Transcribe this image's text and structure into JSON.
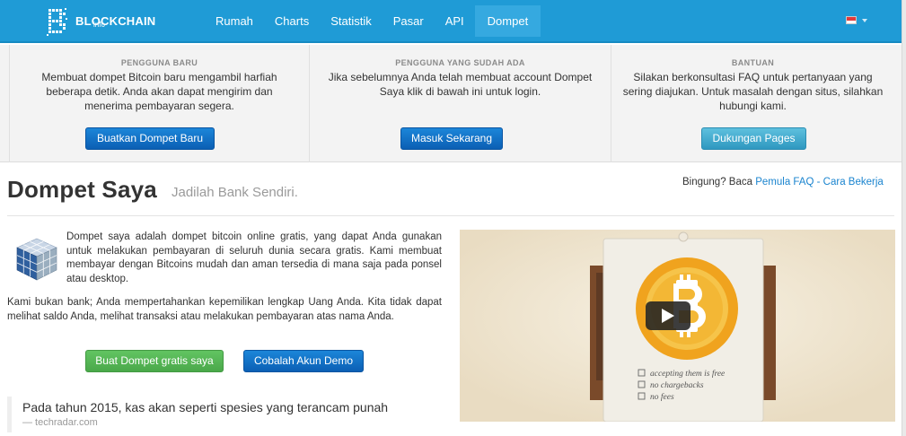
{
  "brand": {
    "name": "BLOCKCHAIN",
    "sub": "info"
  },
  "nav": {
    "items": [
      {
        "label": "Rumah"
      },
      {
        "label": "Charts"
      },
      {
        "label": "Statistik"
      },
      {
        "label": "Pasar"
      },
      {
        "label": "API"
      },
      {
        "label": "Dompet",
        "active": true
      }
    ]
  },
  "band": {
    "new_user": {
      "heading": "PENGGUNA BARU",
      "text": "Membuat dompet Bitcoin baru mengambil harfiah beberapa detik. Anda akan dapat mengirim dan menerima pembayaran segera.",
      "button": "Buatkan Dompet Baru"
    },
    "existing_user": {
      "heading": "PENGGUNA YANG SUDAH ADA",
      "text": "Jika sebelumnya Anda telah membuat account Dompet Saya klik di bawah ini untuk login.",
      "button": "Masuk Sekarang"
    },
    "help": {
      "heading": "BANTUAN",
      "text": "Silakan berkonsultasi FAQ untuk pertanyaan yang sering diajukan. Untuk masalah dengan situs, silahkan hubungi kami.",
      "button": "Dukungan Pages"
    }
  },
  "main": {
    "title": "Dompet Saya",
    "subtitle": "Jadilah Bank Sendiri.",
    "help_prefix": "Bingung? Baca",
    "help_link_faq": "Pemula FAQ",
    "help_sep": "-",
    "help_link_how": "Cara Bekerja",
    "paragraph1": "Dompet saya adalah dompet bitcoin online gratis, yang dapat Anda gunakan untuk melakukan pembayaran di seluruh dunia secara gratis. Kami membuat membayar dengan Bitcoins mudah dan aman tersedia di mana saja pada ponsel atau desktop.",
    "paragraph2": "Kami bukan bank; Anda mempertahankan kepemilikan lengkap Uang Anda. Kita tidak dapat melihat saldo Anda, melihat transaksi atau melakukan pembayaran atas nama Anda.",
    "btn_create": "Buat Dompet gratis saya",
    "btn_demo": "Cobalah Akun Demo",
    "quote": "Pada tahun 2015, kas akan seperti spesies yang terancam punah",
    "quote_source": "— techradar.com"
  },
  "video": {
    "checklist": [
      "accepting them is free",
      "no chargebacks",
      "no fees"
    ]
  },
  "colors": {
    "navbar": "#1f9bd6",
    "nav_active": "#35a9e0",
    "primary_button": "#0b5fb4",
    "info_button": "#2f98c0",
    "success_button": "#4aa84a",
    "link": "#1a84cf"
  },
  "icons": {
    "logo": "blockchain-logo-icon",
    "flag": "indonesia-flag-icon",
    "cube": "wallet-cube-icon",
    "play": "play-icon",
    "coin": "bitcoin-coin-icon"
  }
}
